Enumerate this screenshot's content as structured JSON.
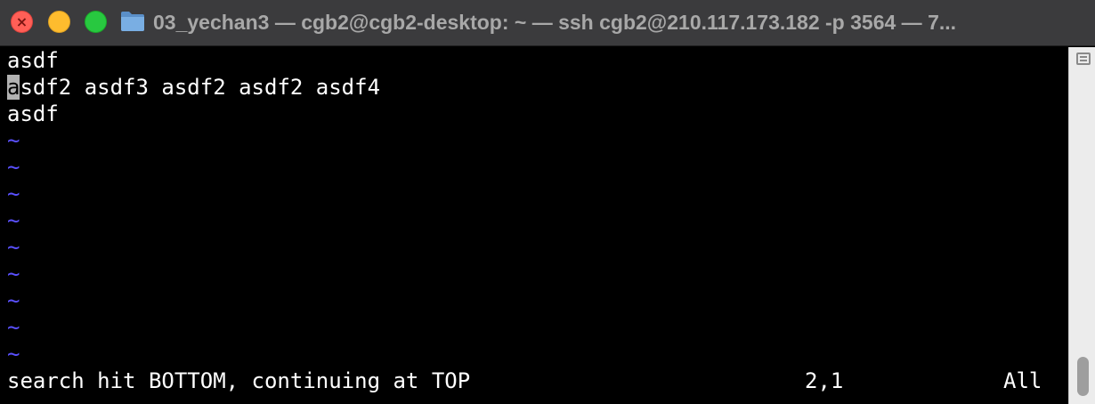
{
  "window": {
    "title": "03_yechan3 — cgb2@cgb2-desktop: ~ — ssh cgb2@210.117.173.182 -p 3564 — 7..."
  },
  "editor": {
    "lines": {
      "l1": "asdf",
      "l2_cursor_char": "a",
      "l2_rest": "sdf2 asdf3 asdf2 asdf2 asdf4",
      "l3": "asdf"
    },
    "empty_line_marker": "~",
    "status": {
      "message": "search hit BOTTOM, continuing at TOP",
      "position": "2,1",
      "scroll": "All"
    }
  },
  "colors": {
    "background": "#000000",
    "text": "#ffffff",
    "tilde": "#5a50ff",
    "cursor": "#b2b2b2",
    "titlebar": "#3b3b3d"
  },
  "icons": {
    "folder": "folder-icon",
    "scroll_menu": "list-menu-icon"
  }
}
